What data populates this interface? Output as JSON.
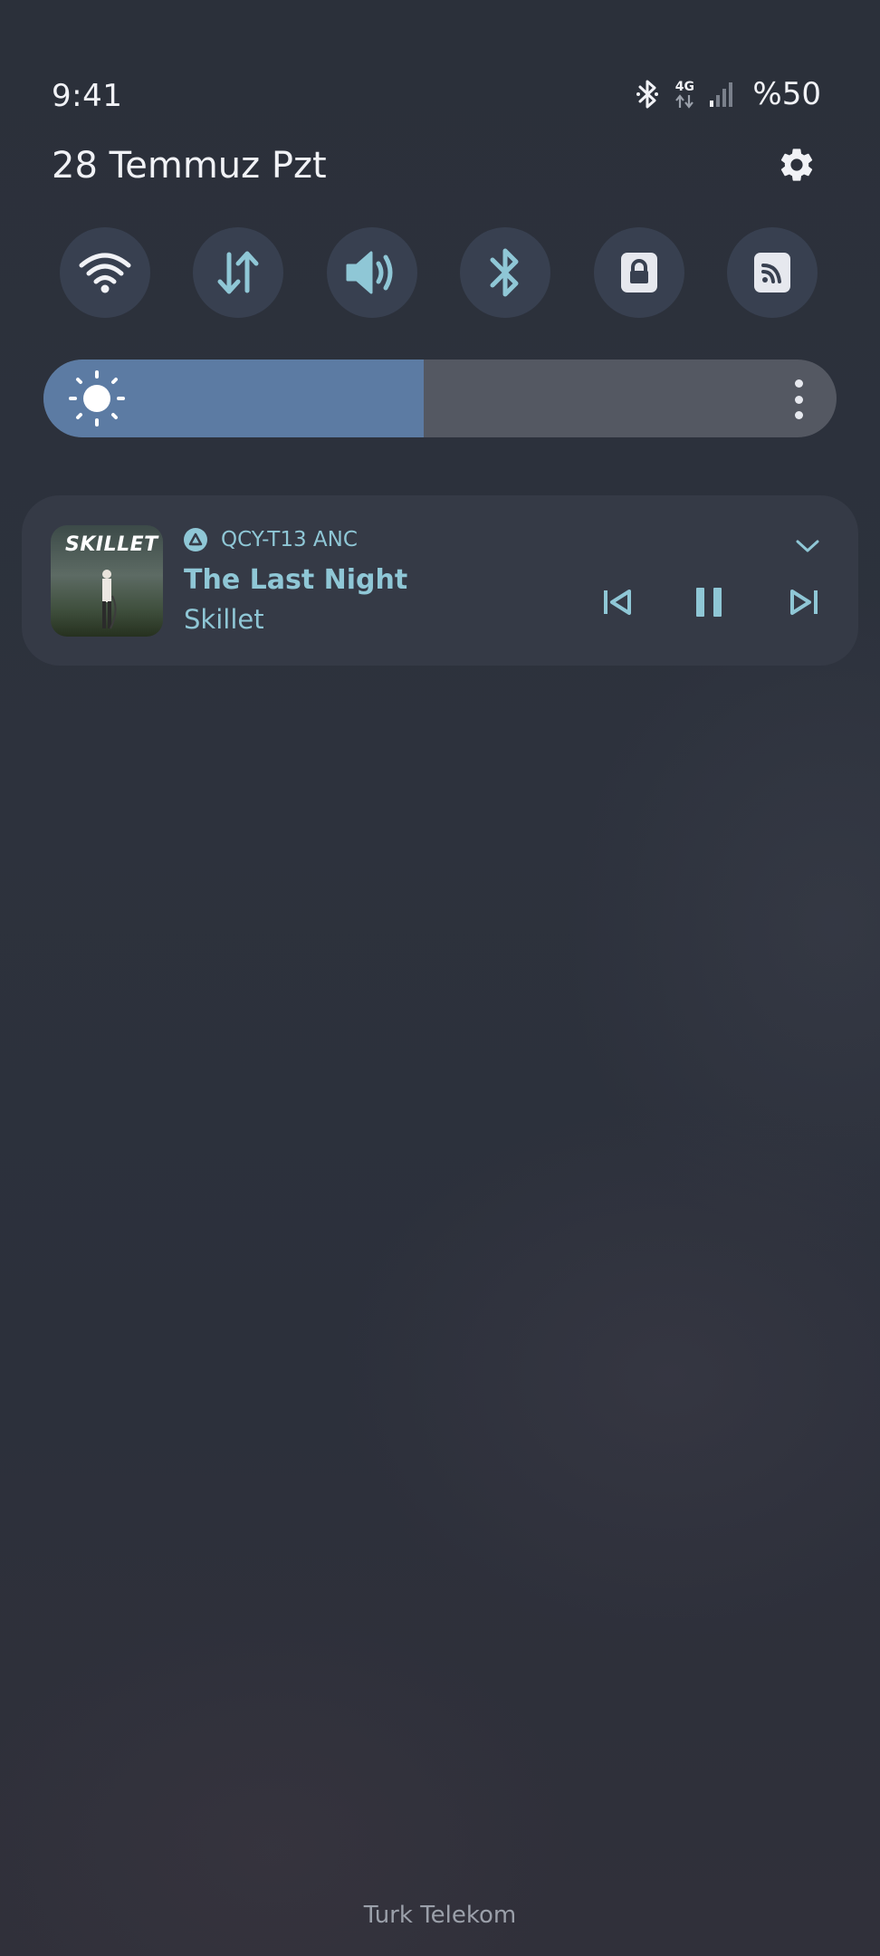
{
  "status_bar": {
    "time": "9:41",
    "network_type": "4G",
    "battery": "%50",
    "icons": [
      "bluetooth-icon",
      "4g-data-icon",
      "signal-icon"
    ]
  },
  "header": {
    "date": "28 Temmuz Pzt",
    "settings_icon": "gear-icon"
  },
  "quick_settings": {
    "tiles": [
      {
        "name": "wifi",
        "icon": "wifi-icon"
      },
      {
        "name": "mobile-data",
        "icon": "data-transfer-icon"
      },
      {
        "name": "sound",
        "icon": "volume-icon"
      },
      {
        "name": "bluetooth",
        "icon": "bluetooth-icon"
      },
      {
        "name": "screen-lock",
        "icon": "lock-icon"
      },
      {
        "name": "cast",
        "icon": "cast-icon"
      }
    ],
    "accent_color": "#8fc7d6"
  },
  "brightness": {
    "level": 0.48,
    "fill_color": "#5c7ba3"
  },
  "media": {
    "album_logo": "SKILLET",
    "output_device": "QCY-T13 ANC",
    "title": "The Last Night",
    "artist": "Skillet",
    "controls": [
      "previous-icon",
      "pause-icon",
      "next-icon"
    ]
  },
  "carrier": "Turk Telekom"
}
